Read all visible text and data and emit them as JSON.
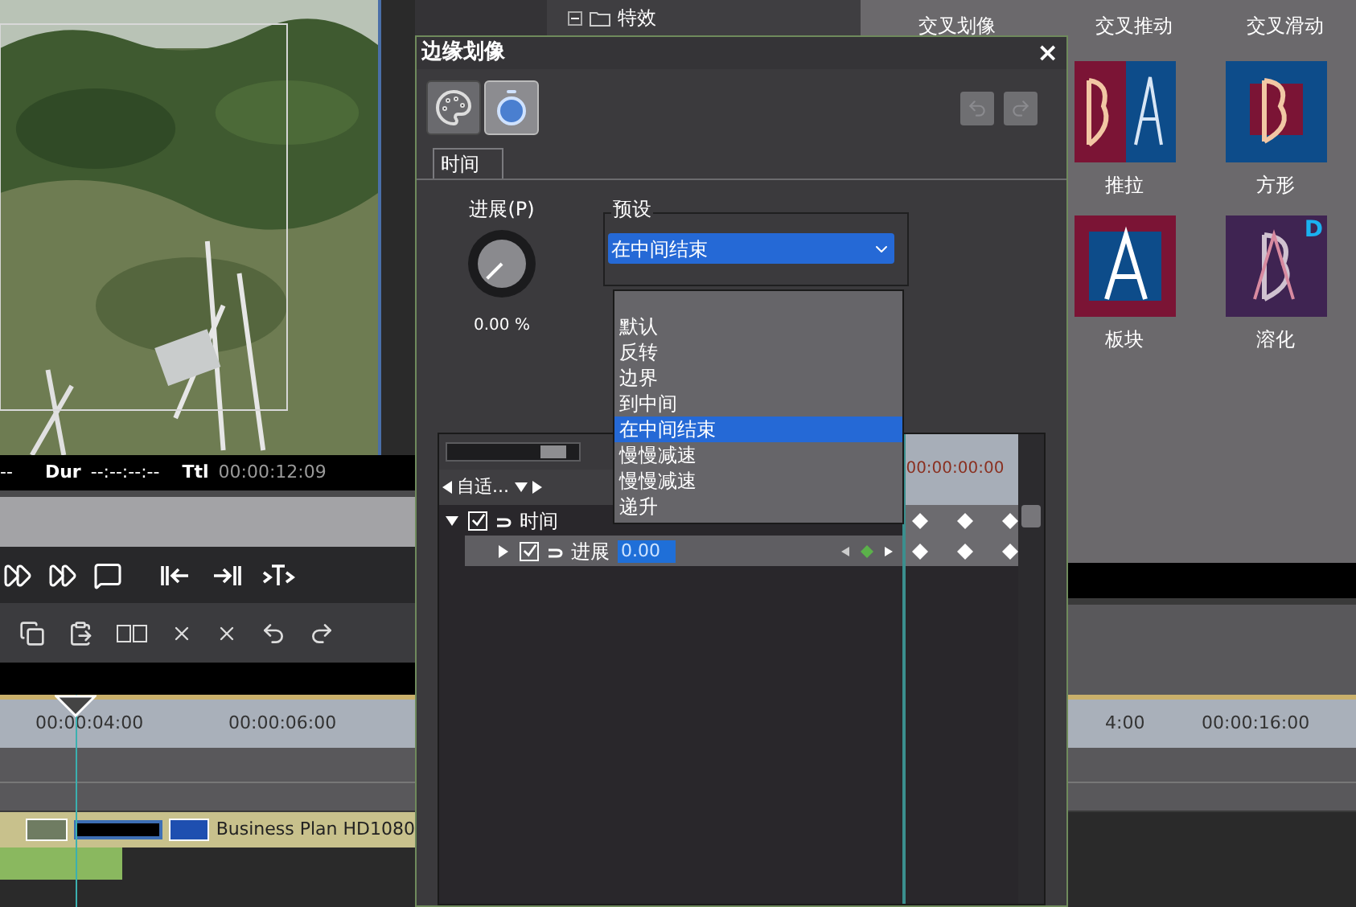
{
  "status_bar": {
    "left": "--",
    "dur_label": "Dur",
    "dur": "--:--:--:--",
    "ttl_label": "Ttl",
    "ttl": "00:00:12:09"
  },
  "effects_tree": {
    "label": "特效",
    "expanded": true
  },
  "transitions": {
    "top_labels": [
      "交叉划像",
      "交叉推动",
      "交叉滑动"
    ],
    "tiles": [
      {
        "label": "推拉",
        "kind": "push"
      },
      {
        "label": "方形",
        "kind": "square"
      },
      {
        "label": "板块",
        "kind": "board"
      },
      {
        "label": "溶化",
        "kind": "dissolve"
      }
    ],
    "dissolve_badge": "D"
  },
  "timeline": {
    "ruler_left": [
      "00:00:04:00",
      "00:00:06:00"
    ],
    "ruler_right": [
      "4:00",
      "00:00:16:00"
    ],
    "clip": "Business Plan HD1080"
  },
  "dialog": {
    "title": "边缘划像",
    "close": "×",
    "modes": [
      {
        "kind": "palette",
        "selected": false
      },
      {
        "kind": "clock",
        "selected": true
      }
    ],
    "undo": {
      "disabled": true
    },
    "redo": {
      "disabled": true
    },
    "tabs": [
      {
        "label": "时间",
        "selected": true
      }
    ],
    "knob": {
      "label": "进展(P)",
      "reading": "0.00 %"
    },
    "preset": {
      "legend": "预设",
      "value": "在中间结束",
      "options": [
        {
          "label": "默认",
          "selected": false
        },
        {
          "label": "反转",
          "selected": false
        },
        {
          "label": "边界",
          "selected": false
        },
        {
          "label": "到中间",
          "selected": false
        },
        {
          "label": "在中间结束",
          "selected": true
        },
        {
          "label": "慢慢减速",
          "selected": false
        },
        {
          "label": "慢慢减速",
          "selected": false
        },
        {
          "label": "递升",
          "selected": false
        }
      ]
    },
    "keyframes": {
      "zoom": {
        "level": 0.85
      },
      "nav": "自适...",
      "timecode": "00:00:00:00",
      "tracks": [
        {
          "label": "时间",
          "expanded": true,
          "checked": true,
          "children": [
            {
              "label": "进展",
              "expanded": false,
              "checked": true,
              "value": "0.00"
            }
          ]
        }
      ]
    }
  }
}
